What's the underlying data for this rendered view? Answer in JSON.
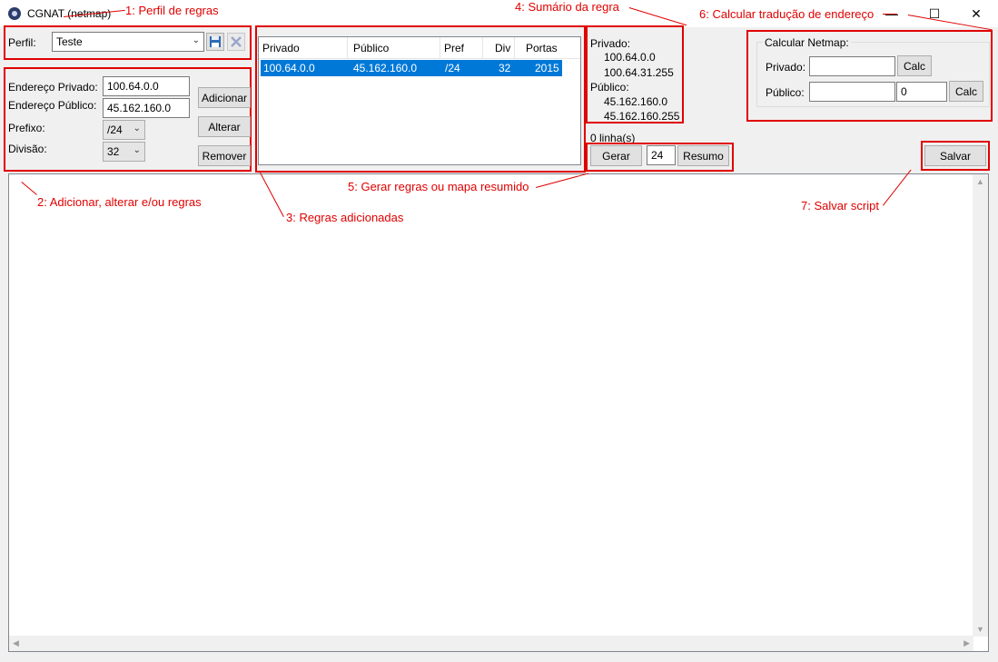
{
  "window": {
    "title": "CGNAT (netmap)",
    "minimize_glyph": "—",
    "maximize_glyph": "☐",
    "close_glyph": "✕"
  },
  "profile": {
    "label": "Perfil:",
    "value": "Teste",
    "save_icon": "save-icon",
    "delete_icon": "delete-icon"
  },
  "rule_form": {
    "private_label": "Endereço Privado:",
    "private_value": "100.64.0.0",
    "public_label": "Endereço Público:",
    "public_value": "45.162.160.0",
    "prefix_label": "Prefixo:",
    "prefix_value": "/24",
    "division_label": "Divisão:",
    "division_value": "32",
    "add_label": "Adicionar",
    "edit_label": "Alterar",
    "remove_label": "Remover"
  },
  "rules_table": {
    "columns": [
      "Privado",
      "Público",
      "Pref",
      "Div",
      "Portas"
    ],
    "rows": [
      [
        "100.64.0.0",
        "45.162.160.0",
        "/24",
        "32",
        "2015"
      ]
    ]
  },
  "summary": {
    "private_heading": "Privado:",
    "private_start": "100.64.0.0",
    "private_end": "100.64.31.255",
    "public_heading": "Público:",
    "public_start": "45.162.160.0",
    "public_end": "45.162.160.255",
    "line_count": "0 linha(s)"
  },
  "generate": {
    "generate_label": "Gerar",
    "size_value": "24",
    "summary_label": "Resumo"
  },
  "netmap_calc": {
    "group_title": "Calcular Netmap:",
    "private_label": "Privado:",
    "private_value": "",
    "public_label": "Público:",
    "public_value": "",
    "port_value": "0",
    "calc_label": "Calc"
  },
  "save": {
    "label": "Salvar"
  },
  "annotations": {
    "a1": "1: Perfil de regras",
    "a2": "2: Adicionar, alterar e/ou regras",
    "a3": "3: Regras adicionadas",
    "a4": "4: Sumário da regra",
    "a5": "5: Gerar regras ou mapa resumido",
    "a6": "6: Calcular tradução de endereço",
    "a7": "7: Salvar script"
  },
  "colors": {
    "highlight": "#e00000",
    "selection": "#0078d7"
  }
}
